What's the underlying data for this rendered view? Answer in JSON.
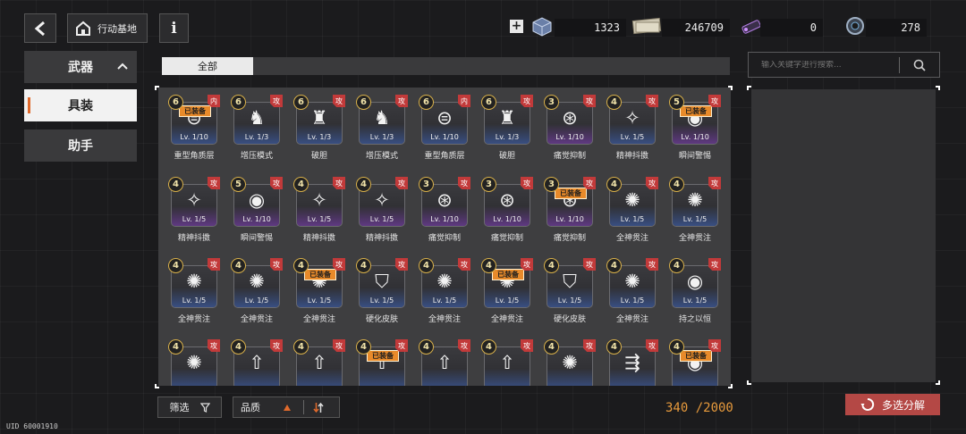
{
  "header": {
    "base_label": "行动基地",
    "info_label": "i",
    "resources": [
      {
        "icon": "supply-crate-icon",
        "value": "1323"
      },
      {
        "icon": "banknote-icon",
        "value": "246709"
      },
      {
        "icon": "chip-icon",
        "value": "0"
      },
      {
        "icon": "gear-part-icon",
        "value": "278"
      }
    ]
  },
  "sidebar": {
    "items": [
      {
        "label": "武器",
        "active": false
      },
      {
        "label": "具装",
        "active": true
      },
      {
        "label": "助手",
        "active": false
      }
    ]
  },
  "filter_tabs": [
    "全部"
  ],
  "inventory": {
    "items": [
      {
        "rarity": "6",
        "tag": "内",
        "name": "重型角质层",
        "level": "Lv. 1/10",
        "equipped": true,
        "icon": "shield-shell-icon",
        "tint": "blue"
      },
      {
        "rarity": "6",
        "tag": "攻",
        "name": "增压模式",
        "level": "Lv. 1/3",
        "equipped": false,
        "icon": "wolf-head-icon",
        "tint": "blue"
      },
      {
        "rarity": "6",
        "tag": "攻",
        "name": "破胆",
        "level": "Lv. 1/3",
        "equipped": false,
        "icon": "beast-mask-icon",
        "tint": "blue"
      },
      {
        "rarity": "6",
        "tag": "攻",
        "name": "增压模式",
        "level": "Lv. 1/3",
        "equipped": false,
        "icon": "wolf-head-icon",
        "tint": "blue"
      },
      {
        "rarity": "6",
        "tag": "内",
        "name": "重型角质层",
        "level": "Lv. 1/10",
        "equipped": false,
        "icon": "shield-shell-icon",
        "tint": "blue"
      },
      {
        "rarity": "6",
        "tag": "攻",
        "name": "破胆",
        "level": "Lv. 1/3",
        "equipped": false,
        "icon": "beast-mask-icon",
        "tint": "blue"
      },
      {
        "rarity": "3",
        "tag": "攻",
        "name": "痛觉抑制",
        "level": "Lv. 1/10",
        "equipped": false,
        "icon": "tri-blade-icon",
        "tint": "purple"
      },
      {
        "rarity": "4",
        "tag": "攻",
        "name": "精神抖擞",
        "level": "Lv. 1/5",
        "equipped": false,
        "icon": "spark-icon",
        "tint": "blue"
      },
      {
        "rarity": "5",
        "tag": "攻",
        "name": "瞬间警惕",
        "level": "Lv. 1/10",
        "equipped": true,
        "icon": "swirl-icon",
        "tint": "purple"
      },
      {
        "rarity": "4",
        "tag": "攻",
        "name": "精神抖擞",
        "level": "Lv. 1/5",
        "equipped": false,
        "icon": "spark-icon",
        "tint": "purple"
      },
      {
        "rarity": "5",
        "tag": "攻",
        "name": "瞬间警惕",
        "level": "Lv. 1/10",
        "equipped": false,
        "icon": "swirl-icon",
        "tint": "purple"
      },
      {
        "rarity": "4",
        "tag": "攻",
        "name": "精神抖擞",
        "level": "Lv. 1/5",
        "equipped": false,
        "icon": "spark-icon",
        "tint": "purple"
      },
      {
        "rarity": "4",
        "tag": "攻",
        "name": "精神抖擞",
        "level": "Lv. 1/5",
        "equipped": false,
        "icon": "spark-icon",
        "tint": "purple"
      },
      {
        "rarity": "3",
        "tag": "攻",
        "name": "痛觉抑制",
        "level": "Lv. 1/10",
        "equipped": false,
        "icon": "tri-blade-icon",
        "tint": "purple"
      },
      {
        "rarity": "3",
        "tag": "攻",
        "name": "痛觉抑制",
        "level": "Lv. 1/10",
        "equipped": false,
        "icon": "tri-blade-icon",
        "tint": "purple"
      },
      {
        "rarity": "3",
        "tag": "攻",
        "name": "痛觉抑制",
        "level": "Lv. 1/10",
        "equipped": true,
        "icon": "tri-blade-icon",
        "tint": "purple"
      },
      {
        "rarity": "4",
        "tag": "攻",
        "name": "全神贯注",
        "level": "Lv. 1/5",
        "equipped": false,
        "icon": "spider-icon",
        "tint": "blue"
      },
      {
        "rarity": "4",
        "tag": "攻",
        "name": "全神贯注",
        "level": "Lv. 1/5",
        "equipped": false,
        "icon": "spider-icon",
        "tint": "blue"
      },
      {
        "rarity": "4",
        "tag": "攻",
        "name": "全神贯注",
        "level": "Lv. 1/5",
        "equipped": false,
        "icon": "spider-icon",
        "tint": "blue"
      },
      {
        "rarity": "4",
        "tag": "攻",
        "name": "全神贯注",
        "level": "Lv. 1/5",
        "equipped": false,
        "icon": "spider-icon",
        "tint": "blue"
      },
      {
        "rarity": "4",
        "tag": "攻",
        "name": "全神贯注",
        "level": "Lv. 1/5",
        "equipped": true,
        "icon": "spider-icon",
        "tint": "blue"
      },
      {
        "rarity": "4",
        "tag": "攻",
        "name": "硬化皮肤",
        "level": "Lv. 1/5",
        "equipped": false,
        "icon": "arrow-shield-icon",
        "tint": "blue"
      },
      {
        "rarity": "4",
        "tag": "攻",
        "name": "全神贯注",
        "level": "Lv. 1/5",
        "equipped": false,
        "icon": "spider-icon",
        "tint": "blue"
      },
      {
        "rarity": "4",
        "tag": "攻",
        "name": "全神贯注",
        "level": "Lv. 1/5",
        "equipped": true,
        "icon": "spider-icon",
        "tint": "blue"
      },
      {
        "rarity": "4",
        "tag": "攻",
        "name": "硬化皮肤",
        "level": "Lv. 1/5",
        "equipped": false,
        "icon": "arrow-shield-icon",
        "tint": "blue"
      },
      {
        "rarity": "4",
        "tag": "攻",
        "name": "全神贯注",
        "level": "Lv. 1/5",
        "equipped": false,
        "icon": "spider-icon",
        "tint": "blue"
      },
      {
        "rarity": "4",
        "tag": "攻",
        "name": "持之以恒",
        "level": "Lv. 1/5",
        "equipped": false,
        "icon": "swirl-icon",
        "tint": "blue"
      },
      {
        "rarity": "4",
        "tag": "攻",
        "name": "",
        "level": "",
        "equipped": false,
        "icon": "spider-icon",
        "tint": "blue"
      },
      {
        "rarity": "4",
        "tag": "攻",
        "name": "",
        "level": "",
        "equipped": false,
        "icon": "rocket-icon",
        "tint": "blue"
      },
      {
        "rarity": "4",
        "tag": "攻",
        "name": "",
        "level": "",
        "equipped": false,
        "icon": "rocket-icon",
        "tint": "blue"
      },
      {
        "rarity": "4",
        "tag": "攻",
        "name": "",
        "level": "",
        "equipped": true,
        "icon": "rocket-icon",
        "tint": "blue"
      },
      {
        "rarity": "4",
        "tag": "攻",
        "name": "",
        "level": "",
        "equipped": false,
        "icon": "rocket-icon",
        "tint": "blue"
      },
      {
        "rarity": "4",
        "tag": "攻",
        "name": "",
        "level": "",
        "equipped": false,
        "icon": "rocket-icon",
        "tint": "blue"
      },
      {
        "rarity": "4",
        "tag": "攻",
        "name": "",
        "level": "",
        "equipped": false,
        "icon": "spider-icon",
        "tint": "blue"
      },
      {
        "rarity": "4",
        "tag": "攻",
        "name": "",
        "level": "",
        "equipped": false,
        "icon": "rails-icon",
        "tint": "blue"
      },
      {
        "rarity": "4",
        "tag": "攻",
        "name": "",
        "level": "",
        "equipped": true,
        "icon": "swirl-icon",
        "tint": "blue"
      }
    ],
    "equipped_label": "已装备"
  },
  "search": {
    "placeholder": "输入关键字进行搜索..."
  },
  "bottom": {
    "filter_label": "筛选",
    "quality_label": "品质",
    "count": "340 /2000",
    "dismantle_label": "多选分解",
    "uid": "UID 60001910"
  }
}
